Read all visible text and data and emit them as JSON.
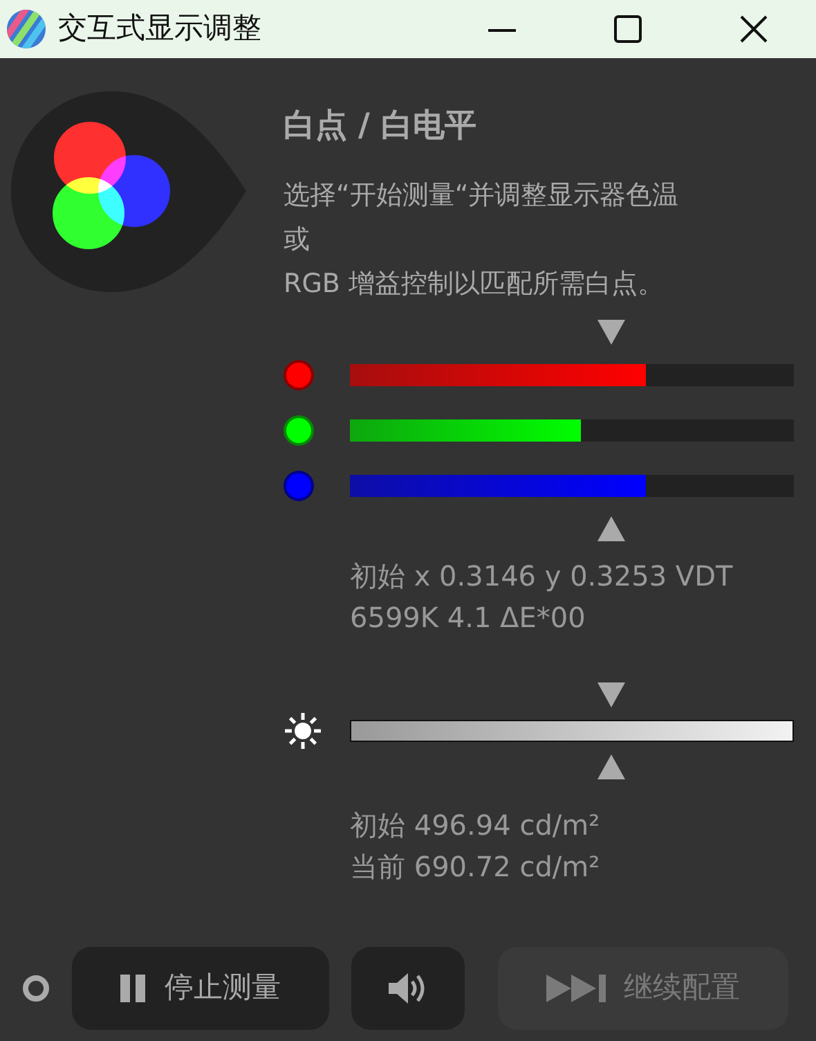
{
  "window": {
    "title": "交互式显示调整"
  },
  "heading": "白点 / 白电平",
  "description_lines": [
    "选择“开始测量“并调整显示器色温",
    "或",
    "RGB 增益控制以匹配所需白点。"
  ],
  "channels": [
    {
      "color": "#ff0000",
      "level": 0.667
    },
    {
      "color": "#00ff00",
      "level": 0.52
    },
    {
      "color": "#0000ff",
      "level": 0.667
    }
  ],
  "rgb_readings": [
    "初始 x 0.3146 y 0.3253 VDT",
    "6599K 4.1 ΔE*00"
  ],
  "brightness_readings": [
    "初始 496.94 cd/m²",
    "当前 690.72 cd/m²"
  ],
  "buttons": [
    {
      "kind": "pause",
      "label": "停止测量",
      "disabled": false
    },
    {
      "kind": "sound",
      "disabled": false
    },
    {
      "kind": "skip",
      "label": "继续配置",
      "disabled": true
    }
  ]
}
